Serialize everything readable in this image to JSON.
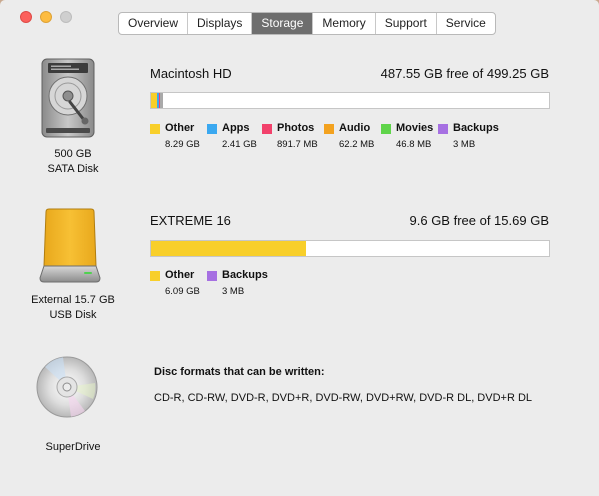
{
  "window": {
    "tabs": [
      {
        "label": "Overview"
      },
      {
        "label": "Displays"
      },
      {
        "label": "Storage"
      },
      {
        "label": "Memory"
      },
      {
        "label": "Support"
      },
      {
        "label": "Service"
      }
    ],
    "active_tab": "Storage"
  },
  "colors": {
    "other": "#f8cf2a",
    "apps": "#3aa8f0",
    "photos": "#f2416b",
    "audio": "#f3a21f",
    "movies": "#5fd44a",
    "backups": "#a670e2"
  },
  "disks": [
    {
      "icon": "internal-hard-disk-icon",
      "label_line1": "500 GB",
      "label_line2": "SATA Disk",
      "name": "Macintosh HD",
      "free_text": "487.55 GB free of 499.25 GB",
      "usage": [
        {
          "category": "Other",
          "size": "8.29 GB"
        },
        {
          "category": "Apps",
          "size": "2.41 GB"
        },
        {
          "category": "Photos",
          "size": "891.7 MB"
        },
        {
          "category": "Audio",
          "size": "62.2 MB"
        },
        {
          "category": "Movies",
          "size": "46.8 MB"
        },
        {
          "category": "Backups",
          "size": "3 MB"
        }
      ]
    },
    {
      "icon": "external-usb-disk-icon",
      "label_line1": "External 15.7 GB",
      "label_line2": "USB Disk",
      "name": "EXTREME 16",
      "free_text": "9.6 GB free of 15.69 GB",
      "usage": [
        {
          "category": "Other",
          "size": "6.09 GB"
        },
        {
          "category": "Backups",
          "size": "3 MB"
        }
      ]
    }
  ],
  "superdrive": {
    "icon": "optical-disc-icon",
    "label": "SuperDrive",
    "formats_title": "Disc formats that can be written:",
    "formats": "CD-R, CD-RW, DVD-R, DVD+R, DVD-RW, DVD+RW, DVD-R DL, DVD+R DL"
  }
}
